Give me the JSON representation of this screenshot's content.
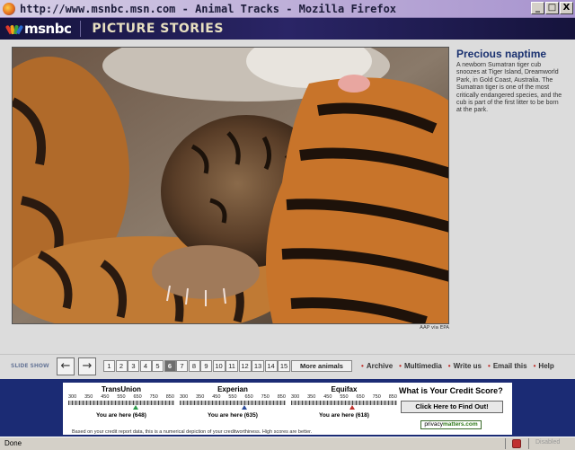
{
  "window": {
    "title": "http://www.msnbc.msn.com - Animal Tracks - Mozilla Firefox",
    "controls": [
      "_",
      "□",
      "X"
    ]
  },
  "header": {
    "brand": "msnbc",
    "section": "PICTURE STORIES"
  },
  "photo": {
    "credit": "AAP via EPA"
  },
  "caption": {
    "title": "Precious naptime",
    "body": "A newborn Sumatran tiger cub snoozes at Tiger Island, Dreamworld Park, in Gold Coast, Australia. The Sumatran tiger is one of the most critically endangered species, and the cub is part of the first litter to be born at the park."
  },
  "nav": {
    "label": "SLIDE SHOW",
    "prev": "←",
    "next": "→",
    "pages": [
      "1",
      "2",
      "3",
      "4",
      "5",
      "6",
      "7",
      "8",
      "9",
      "10",
      "11",
      "12",
      "13",
      "14",
      "15"
    ],
    "current_page": "6",
    "more_label": "More animals",
    "links": [
      "Archive",
      "Multimedia",
      "Write us",
      "Email this",
      "Help"
    ]
  },
  "ad": {
    "bureaus": [
      {
        "name": "TransUnion",
        "score_text": "You are here (648)",
        "score": 648,
        "marker_color": "#2a9a4a"
      },
      {
        "name": "Experian",
        "score_text": "You are here (635)",
        "score": 635,
        "marker_color": "#2a4a9a"
      },
      {
        "name": "Equifax",
        "score_text": "You are here (618)",
        "score": 618,
        "marker_color": "#c0302a"
      }
    ],
    "scale_ticks": [
      "300",
      "350",
      "450",
      "550",
      "650",
      "750",
      "850"
    ],
    "scale_range": [
      300,
      850
    ],
    "question": "What is Your Credit Score?",
    "button_label": "Click Here to Find Out!",
    "logo_prefix": "privacy",
    "logo_suffix": "matters.com",
    "disclaimer": "Based on your credit report data, this is a numerical depiction of your creditworthiness. High scores are better."
  },
  "status": {
    "text": "Done",
    "right": "Disabled"
  }
}
